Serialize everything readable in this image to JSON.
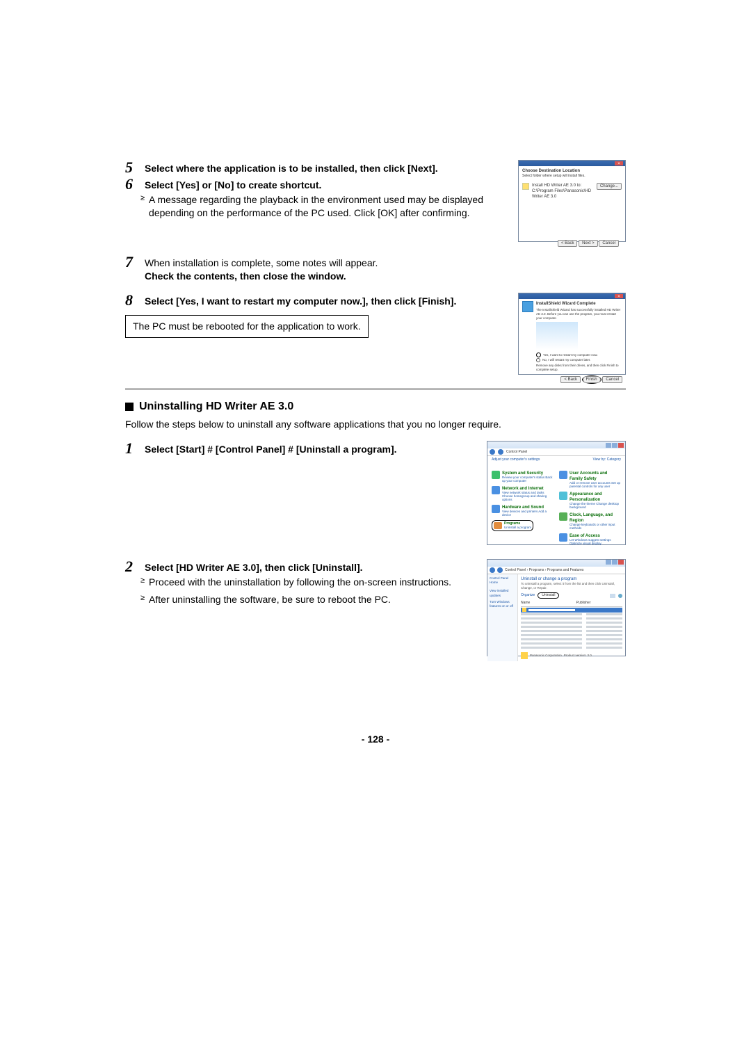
{
  "steps": {
    "s5": {
      "num": "5",
      "text": "Select where the application is to be installed, then click [Next]."
    },
    "s6": {
      "num": "6",
      "text": "Select [Yes] or [No] to create shortcut."
    },
    "s6_bullet": "A message regarding the playback in the environment used may be displayed depending on the performance of the PC used. Click [OK] after confirming.",
    "s7": {
      "num": "7",
      "text_plain": "When installation is complete, some notes will appear.",
      "text_bold": "Check the contents, then close the window."
    },
    "s8": {
      "num": "8",
      "text": "Select [Yes, I want to restart my computer now.], then click [Finish]."
    },
    "s8_note": "The PC must be rebooted for the application to work."
  },
  "uninstall": {
    "heading": "Uninstalling HD Writer AE 3.0",
    "intro": "Follow the steps below to uninstall any software applications that you no longer require.",
    "u1": {
      "num": "1",
      "pre": "Select [Start] ",
      "arrow1": "#",
      "mid1": " [Control Panel] ",
      "arrow2": "#",
      "post": " [Uninstall a program]."
    },
    "u2": {
      "num": "2",
      "text": "Select [HD Writer AE 3.0], then click [Uninstall]."
    },
    "u2_b1": "Proceed with the uninstallation by following the on-screen instructions.",
    "u2_b2": "After uninstalling the software, be sure to reboot the PC."
  },
  "scr1": {
    "title1": "Choose Destination Location",
    "title2": "Select folder where setup will install files.",
    "row1": "Install HD Writer AE 3.0 to:",
    "row2": "C:\\Program Files\\Panasonic\\HD Writer AE 3.0",
    "change": "Change...",
    "back": "< Back",
    "next": "Next >",
    "cancel": "Cancel"
  },
  "scr2": {
    "head": "InstallShield Wizard Complete",
    "msg": "The InstallShield Wizard has successfully installed HD Writer AE 3.0. Before you can use the program, you must restart your computer.",
    "opt1": "Yes, I want to restart my computer now.",
    "opt2": "No, I will restart my computer later.",
    "foot": "Remove any disks from their drives, and then click Finish to complete setup.",
    "back": "< Back",
    "finish": "Finish",
    "cancel": "Cancel"
  },
  "scr3": {
    "crumb": "Control Panel",
    "hdr": "Adjust your computer's settings",
    "view": "View by:",
    "cat": "Category",
    "i1t": "System and Security",
    "i1s": "Review your computer's status\nBack up your computer",
    "i2t": "Network and Internet",
    "i2s": "View network status and tasks\nChoose homegroup and sharing options",
    "i3t": "Hardware and Sound",
    "i3s": "View devices and printers\nAdd a device",
    "i4t": "Programs",
    "i4s": "Uninstall a program",
    "i5t": "User Accounts and Family Safety",
    "i5s": "Add or remove user accounts\nSet up parental controls for any user",
    "i6t": "Appearance and Personalization",
    "i6s": "Change the theme\nChange desktop background",
    "i7t": "Clock, Language, and Region",
    "i7s": "Change keyboards or other input methods",
    "i8t": "Ease of Access",
    "i8s": "Let Windows suggest settings\nOptimize visual display"
  },
  "scr4": {
    "crumb": "Control Panel › Programs › Programs and Features",
    "side1": "Control Panel Home",
    "side2": "View installed updates",
    "side3": "Turn Windows features on or off",
    "mh": "Uninstall or change a program",
    "ms": "To uninstall a program, select it from the list and then click Uninstall, Change, or Repair.",
    "org": "Organize",
    "unin": "Uninstall",
    "col1": "Name",
    "col2": "Publisher",
    "status_name": "Panasonic Corporation",
    "status_ver": "Product version: 3.0"
  },
  "page": "- 128 -"
}
